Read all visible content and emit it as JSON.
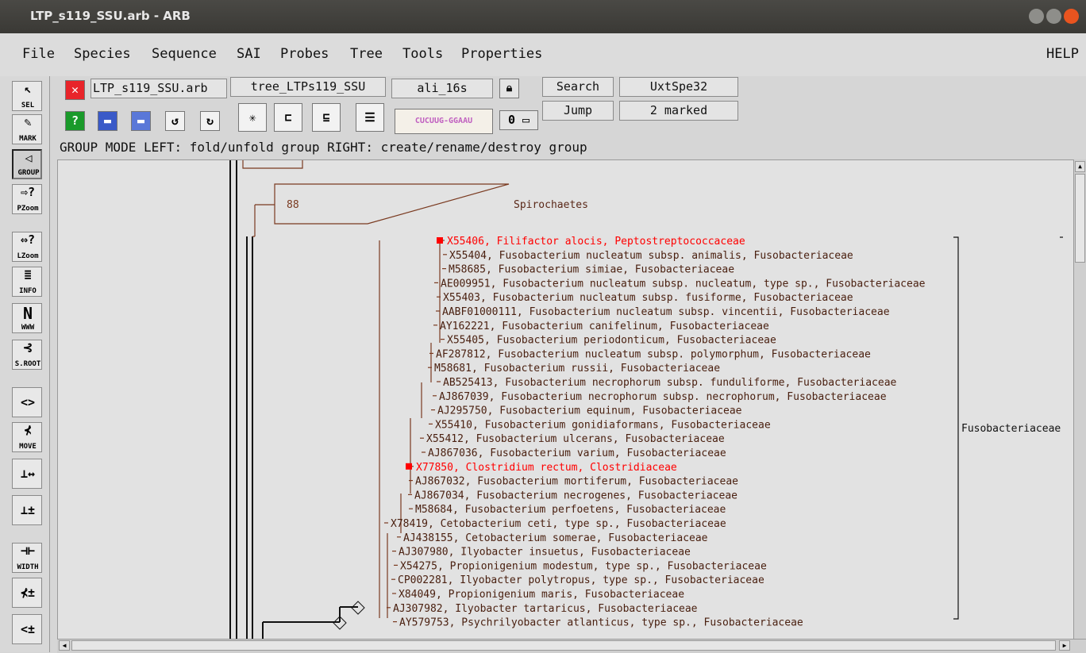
{
  "window": {
    "title": "LTP_s119_SSU.arb - ARB"
  },
  "menubar": {
    "items": [
      "File",
      "Species",
      "Sequence",
      "SAI",
      "Probes",
      "Tree",
      "Tools",
      "Properties"
    ],
    "help": "HELP"
  },
  "sidebar": {
    "tools": [
      {
        "name": "select-tool",
        "label": "SEL",
        "glyph": "↖"
      },
      {
        "name": "mark-tool",
        "label": "MARK",
        "glyph": "✎"
      },
      {
        "name": "group-tool",
        "label": "GROUP",
        "glyph": "◁"
      },
      {
        "name": "pzoom-tool",
        "label": "PZoom",
        "glyph": "⇨?"
      },
      {
        "name": "lzoom-tool",
        "label": "LZoom",
        "glyph": "⇔?"
      },
      {
        "name": "info-tool",
        "label": "INFO",
        "glyph": "≣"
      },
      {
        "name": "www-tool",
        "label": "WWW",
        "glyph": "N"
      },
      {
        "name": "setroot-tool",
        "label": "S.ROOT",
        "glyph": "⊰"
      },
      {
        "name": "swap-tool",
        "label": "",
        "glyph": "<>"
      },
      {
        "name": "move-tool",
        "label": "MOVE",
        "glyph": "⊀"
      },
      {
        "name": "length-tool",
        "label": "",
        "glyph": "⊥↔"
      },
      {
        "name": "multi-length-tool",
        "label": "",
        "glyph": "⊥±"
      },
      {
        "name": "width-tool",
        "label": "WIDTH",
        "glyph": "⊣⊢"
      },
      {
        "name": "rotate-tool",
        "label": "",
        "glyph": "⊀±"
      },
      {
        "name": "spread-tool",
        "label": "",
        "glyph": "<±"
      }
    ]
  },
  "toolbar": {
    "db_name": "LTP_s119_SSU.arb",
    "tree_name": "tree_LTPs119_SSU",
    "alignment": "ali_16s",
    "search_label": "Search",
    "jump_label": "Jump",
    "species_label": "UxtSpe32",
    "marked_label": "2 marked",
    "zero_value": "0",
    "status": "GROUP MODE  LEFT: fold/unfold group  RIGHT: create/rename/destroy group"
  },
  "tree": {
    "bootstrap": "88",
    "collapsed_group": "Spirochaetes",
    "group_label": "Fusobacteriaceae",
    "leaves": [
      {
        "text": "X55406, Filifactor alocis, Peptostreptococcaceae",
        "marked": true
      },
      {
        "text": "X55404, Fusobacterium nucleatum subsp. animalis, Fusobacteriaceae",
        "marked": false
      },
      {
        "text": "M58685, Fusobacterium simiae, Fusobacteriaceae",
        "marked": false
      },
      {
        "text": "AE009951, Fusobacterium nucleatum subsp. nucleatum, type sp., Fusobacteriaceae",
        "marked": false
      },
      {
        "text": "X55403, Fusobacterium nucleatum subsp. fusiforme, Fusobacteriaceae",
        "marked": false
      },
      {
        "text": "AABF01000111, Fusobacterium nucleatum subsp. vincentii, Fusobacteriaceae",
        "marked": false
      },
      {
        "text": "AY162221, Fusobacterium canifelinum, Fusobacteriaceae",
        "marked": false
      },
      {
        "text": "X55405, Fusobacterium periodonticum, Fusobacteriaceae",
        "marked": false
      },
      {
        "text": "AF287812, Fusobacterium nucleatum subsp. polymorphum, Fusobacteriaceae",
        "marked": false
      },
      {
        "text": "M58681, Fusobacterium russii, Fusobacteriaceae",
        "marked": false
      },
      {
        "text": "AB525413, Fusobacterium necrophorum subsp. funduliforme, Fusobacteriaceae",
        "marked": false
      },
      {
        "text": "AJ867039, Fusobacterium necrophorum subsp. necrophorum, Fusobacteriaceae",
        "marked": false
      },
      {
        "text": "AJ295750, Fusobacterium equinum, Fusobacteriaceae",
        "marked": false
      },
      {
        "text": "X55410, Fusobacterium gonidiaformans, Fusobacteriaceae",
        "marked": false
      },
      {
        "text": "X55412, Fusobacterium ulcerans, Fusobacteriaceae",
        "marked": false
      },
      {
        "text": "AJ867036, Fusobacterium varium, Fusobacteriaceae",
        "marked": false
      },
      {
        "text": "X77850, Clostridium rectum, Clostridiaceae",
        "marked": true
      },
      {
        "text": "AJ867032, Fusobacterium mortiferum, Fusobacteriaceae",
        "marked": false
      },
      {
        "text": "AJ867034, Fusobacterium necrogenes, Fusobacteriaceae",
        "marked": false
      },
      {
        "text": "M58684, Fusobacterium perfoetens, Fusobacteriaceae",
        "marked": false
      },
      {
        "text": "X78419, Cetobacterium ceti, type sp., Fusobacteriaceae",
        "marked": false
      },
      {
        "text": "AJ438155, Cetobacterium somerae, Fusobacteriaceae",
        "marked": false
      },
      {
        "text": "AJ307980, Ilyobacter insuetus, Fusobacteriaceae",
        "marked": false
      },
      {
        "text": "X54275, Propionigenium modestum, type sp., Fusobacteriaceae",
        "marked": false
      },
      {
        "text": "CP002281, Ilyobacter polytropus, type sp., Fusobacteriaceae",
        "marked": false
      },
      {
        "text": "X84049, Propionigenium maris, Fusobacteriaceae",
        "marked": false
      },
      {
        "text": "AJ307982, Ilyobacter tartaricus, Fusobacteriaceae",
        "marked": false
      },
      {
        "text": "AY579753, Psychrilyobacter atlanticus, type sp., Fusobacteriaceae",
        "marked": false
      }
    ]
  }
}
